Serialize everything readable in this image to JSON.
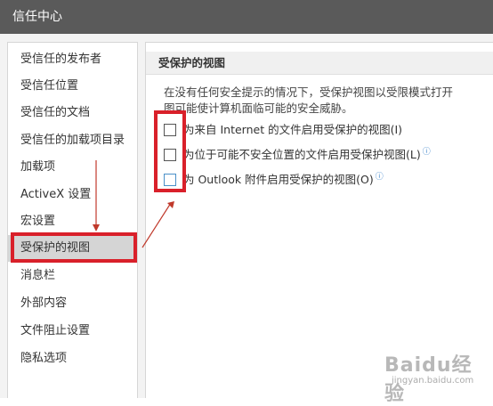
{
  "window": {
    "title": "信任中心"
  },
  "sidebar": {
    "items": [
      {
        "label": "受信任的发布者"
      },
      {
        "label": "受信任位置"
      },
      {
        "label": "受信任的文档"
      },
      {
        "label": "受信任的加载项目录"
      },
      {
        "label": "加载项"
      },
      {
        "label": "ActiveX 设置"
      },
      {
        "label": "宏设置"
      },
      {
        "label": "受保护的视图",
        "selected": true
      },
      {
        "label": "消息栏"
      },
      {
        "label": "外部内容"
      },
      {
        "label": "文件阻止设置"
      },
      {
        "label": "隐私选项"
      }
    ]
  },
  "main": {
    "section_title": "受保护的视图",
    "description": [
      "在没有任何安全提示的情况下，受保护视图以受限模式打开",
      "图可能使计算机面临可能的安全威胁。"
    ],
    "options": [
      {
        "label": "为来自 Internet 的文件启用受保护的视图(I)",
        "checked": false,
        "info_icon": false
      },
      {
        "label": "为位于可能不安全位置的文件启用受保护视图(L)",
        "checked": false,
        "info_icon": true
      },
      {
        "label": "为 Outlook 附件启用受保护的视图(O)",
        "checked": false,
        "info_icon": true
      }
    ],
    "info_icon_glyph": "ⓘ"
  },
  "annotation": {
    "highlight_color": "#d9202a",
    "arrow_color": "#c0392b"
  },
  "watermark": {
    "logo": "Baidu经验",
    "sub": "jingyan.baidu.com"
  }
}
